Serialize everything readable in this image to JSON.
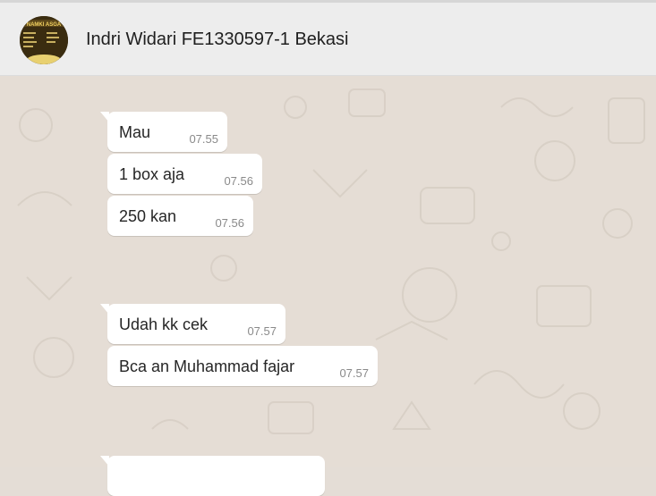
{
  "header": {
    "title": "Indri Widari FE1330597-1 Bekasi",
    "avatar_text": "NAMKI ASGA"
  },
  "messages": [
    {
      "text": "Mau",
      "time": "07.55"
    },
    {
      "text": "1 box aja",
      "time": "07.56"
    },
    {
      "text": "250 kan",
      "time": "07.56"
    },
    {
      "text": "Udah kk cek",
      "time": "07.57"
    },
    {
      "text": "Bca an Muhammad fajar",
      "time": "07.57"
    },
    {
      "text": "",
      "time": ""
    }
  ],
  "colors": {
    "chat_background": "#e5ddd5",
    "header_background": "#ededed",
    "bubble": "#ffffff",
    "time_text": "#8a8a8a"
  }
}
